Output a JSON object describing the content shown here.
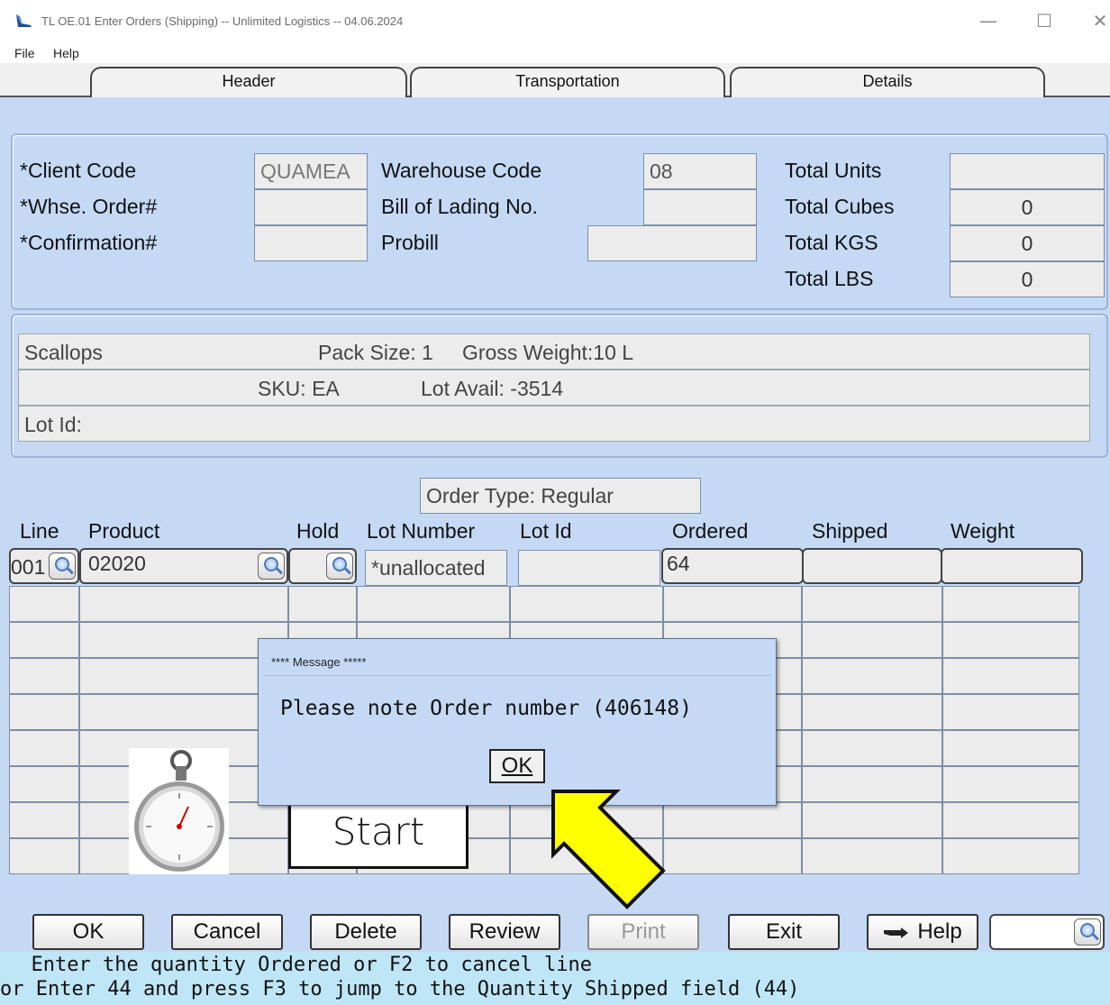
{
  "window": {
    "title": "TL OE.01 Enter Orders (Shipping) -- Unlimited Logistics -- 04.06.2024",
    "minimize": "—",
    "maximize": "☐",
    "close": "✕"
  },
  "menu": {
    "file": "File",
    "help": "Help"
  },
  "tabs": [
    {
      "label": "Header"
    },
    {
      "label": "Transportation"
    },
    {
      "label": "Details"
    }
  ],
  "header_fields": {
    "client_code_label": "*Client Code",
    "client_code_value": "QUAMEA",
    "whse_order_label": "*Whse. Order#",
    "whse_order_value": "",
    "confirmation_label": "*Confirmation#",
    "confirmation_value": "",
    "warehouse_code_label": "Warehouse Code",
    "warehouse_code_value": "08",
    "bill_of_lading_label": "Bill of Lading No.",
    "bill_of_lading_value": "",
    "probill_label": "Probill",
    "probill_value": "",
    "total_units_label": "Total Units",
    "total_units_value": "",
    "total_cubes_label": "Total Cubes",
    "total_cubes_value": "0",
    "total_kgs_label": "Total KGS",
    "total_kgs_value": "0",
    "total_lbs_label": "Total LBS",
    "total_lbs_value": "0"
  },
  "product_info": {
    "name": "Scallops",
    "pack_size": "Pack Size: 1",
    "gross_weight": "Gross Weight:10 L",
    "sku": "SKU: EA",
    "lot_avail": "Lot Avail: -3514",
    "lot_id": "Lot Id:"
  },
  "order_type": "Order Type:  Regular",
  "line_grid": {
    "columns": [
      "Line",
      "Product",
      "Hold",
      "Lot Number",
      "Lot Id",
      "Ordered",
      "Shipped",
      "Weight"
    ],
    "current_row": {
      "line": "001",
      "product": "02020",
      "hold": "",
      "lot_number": "*unallocated",
      "lot_id": "",
      "ordered": "64",
      "shipped": "",
      "weight": ""
    }
  },
  "dialog": {
    "title": "**** Message *****",
    "message": "Please note Order number (406148)",
    "ok_label": "OK"
  },
  "annotation": {
    "start_label": "Start"
  },
  "buttons": {
    "ok": "OK",
    "cancel": "Cancel",
    "delete": "Delete",
    "review": "Review",
    "print": "Print",
    "exit": "Exit",
    "help": "Help"
  },
  "status": {
    "line1": "  Enter the quantity Ordered or F2 to cancel line",
    "line2": "or Enter 44 and press F3 to jump to the Quantity Shipped field (44)"
  },
  "colors": {
    "background": "#c5d9f5",
    "field": "#ececec",
    "status_bar": "#bfe6f7",
    "arrow": "#ffff00"
  }
}
